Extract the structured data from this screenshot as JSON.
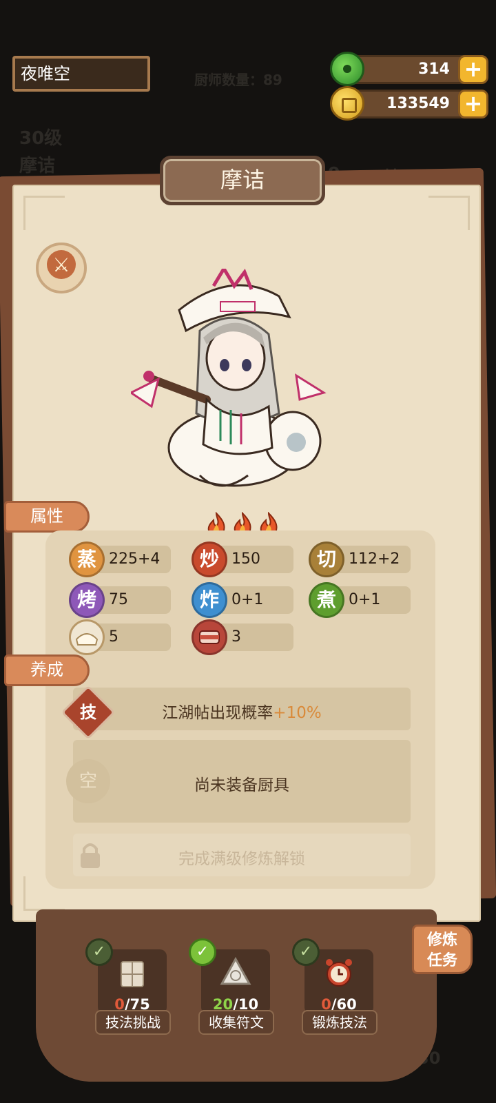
{
  "player": {
    "name": "夜唯空"
  },
  "background": {
    "chef_count": "厨师数量：89",
    "level": "30级",
    "chef_name": "摩诘",
    "right_stats": [
      "9",
      "炒150"
    ],
    "bottom_level": "30"
  },
  "currency": [
    {
      "icon": "jade-icon",
      "value": "314",
      "plus": "+"
    },
    {
      "icon": "coin-icon",
      "value": "133549",
      "plus": "+"
    }
  ],
  "panel": {
    "title": "摩诘"
  },
  "tabs": {
    "attributes": "属性",
    "growth": "养成"
  },
  "rarity_flames": 3,
  "attributes": [
    {
      "icon": "蒸",
      "value": "225+4",
      "color": "#e09440"
    },
    {
      "icon": "炒",
      "value": "150",
      "color": "#c94a2c"
    },
    {
      "icon": "切",
      "value": "112+2",
      "color": "#a88038"
    },
    {
      "icon": "烤",
      "value": "75",
      "color": "#8e58b8"
    },
    {
      "icon": "炸",
      "value": "0+1",
      "color": "#3e8fd0"
    },
    {
      "icon": "煮",
      "value": "0+1",
      "color": "#5e9e2e"
    },
    {
      "icon": "",
      "value": "5",
      "color": "#e8dcc4"
    },
    {
      "icon": "",
      "value": "3",
      "color": "#b8463a"
    }
  ],
  "growth": {
    "skill_icon": "技",
    "skill_text": "江湖帖出现概率",
    "skill_bonus": "+10%",
    "equip_icon": "空",
    "equip_text": "尚未装备厨具",
    "locked_text": "完成满级修炼解锁"
  },
  "tasks": [
    {
      "done": false,
      "progress": "0",
      "total": "/75",
      "label": "技法挑战"
    },
    {
      "done": true,
      "progress": "20",
      "total": "/10",
      "label": "收集符文"
    },
    {
      "done": false,
      "progress": "0",
      "total": "/60",
      "label": "锻炼技法"
    }
  ],
  "train_button": {
    "line1": "修炼",
    "line2": "任务"
  },
  "colors": {
    "accent_orange": "#d98a5a",
    "bonus": "#d98a3a",
    "progress_red": "#e05a3a",
    "progress_green": "#8fd34a"
  }
}
